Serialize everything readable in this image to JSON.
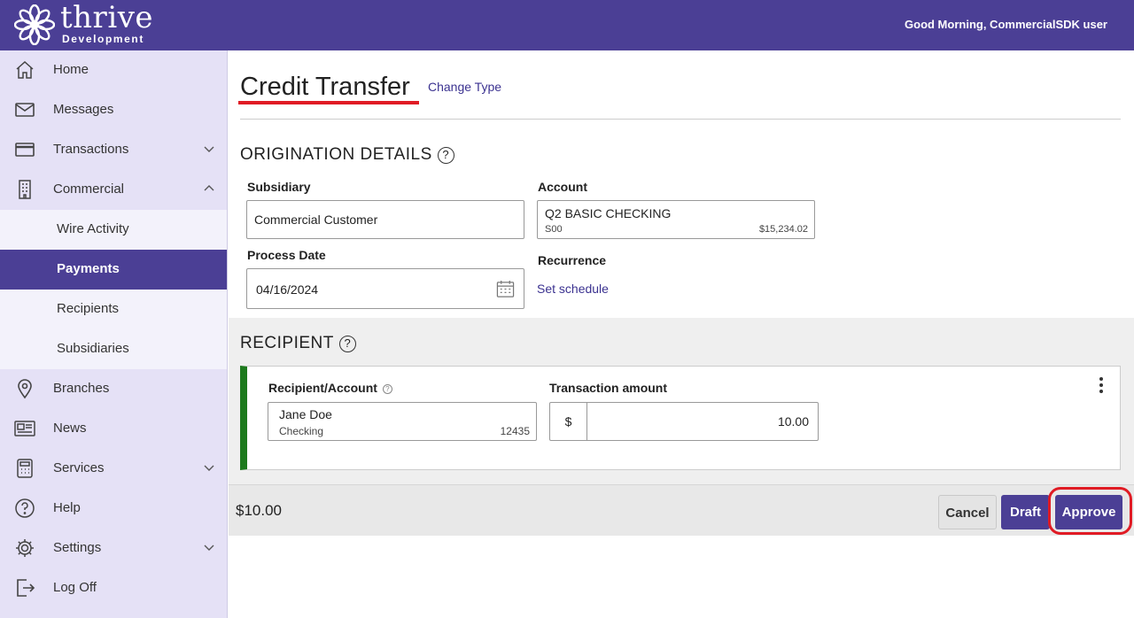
{
  "header": {
    "brand_name": "thrive",
    "brand_sub": "Development",
    "greeting": "Good Morning, CommercialSDK user",
    "color": "#4b3f95"
  },
  "sidebar": {
    "items": [
      {
        "label": "Home",
        "icon": "home-icon"
      },
      {
        "label": "Messages",
        "icon": "envelope-icon"
      },
      {
        "label": "Transactions",
        "icon": "credit-card-icon",
        "expandable": true
      },
      {
        "label": "Commercial",
        "icon": "building-icon",
        "expanded": true
      },
      {
        "label": "Branches",
        "icon": "map-pin-icon"
      },
      {
        "label": "News",
        "icon": "newspaper-icon"
      },
      {
        "label": "Services",
        "icon": "calculator-icon",
        "expandable": true
      },
      {
        "label": "Help",
        "icon": "question-circle-icon"
      },
      {
        "label": "Settings",
        "icon": "gear-icon",
        "expandable": true
      },
      {
        "label": "Log Off",
        "icon": "logout-icon"
      }
    ],
    "commercial_sub": [
      {
        "label": "Wire Activity"
      },
      {
        "label": "Payments",
        "active": true
      },
      {
        "label": "Recipients"
      },
      {
        "label": "Subsidiaries"
      }
    ]
  },
  "page": {
    "title": "Credit Transfer",
    "change_type": "Change Type"
  },
  "origination": {
    "title": "ORIGINATION DETAILS",
    "subsidiary_label": "Subsidiary",
    "subsidiary_value": "Commercial Customer",
    "account_label": "Account",
    "account_name": "Q2 BASIC CHECKING",
    "account_code": "S00",
    "account_balance": "$15,234.02",
    "process_date_label": "Process Date",
    "process_date_value": "04/16/2024",
    "recurrence_label": "Recurrence",
    "set_schedule": "Set schedule"
  },
  "recipient": {
    "title": "RECIPIENT",
    "recipient_label": "Recipient/Account",
    "recipient_name": "Jane Doe",
    "recipient_type": "Checking",
    "recipient_account": "12435",
    "amount_label": "Transaction amount",
    "currency": "$",
    "amount": "10.00"
  },
  "footer": {
    "total": "$10.00",
    "cancel": "Cancel",
    "draft": "Draft",
    "approve": "Approve"
  }
}
